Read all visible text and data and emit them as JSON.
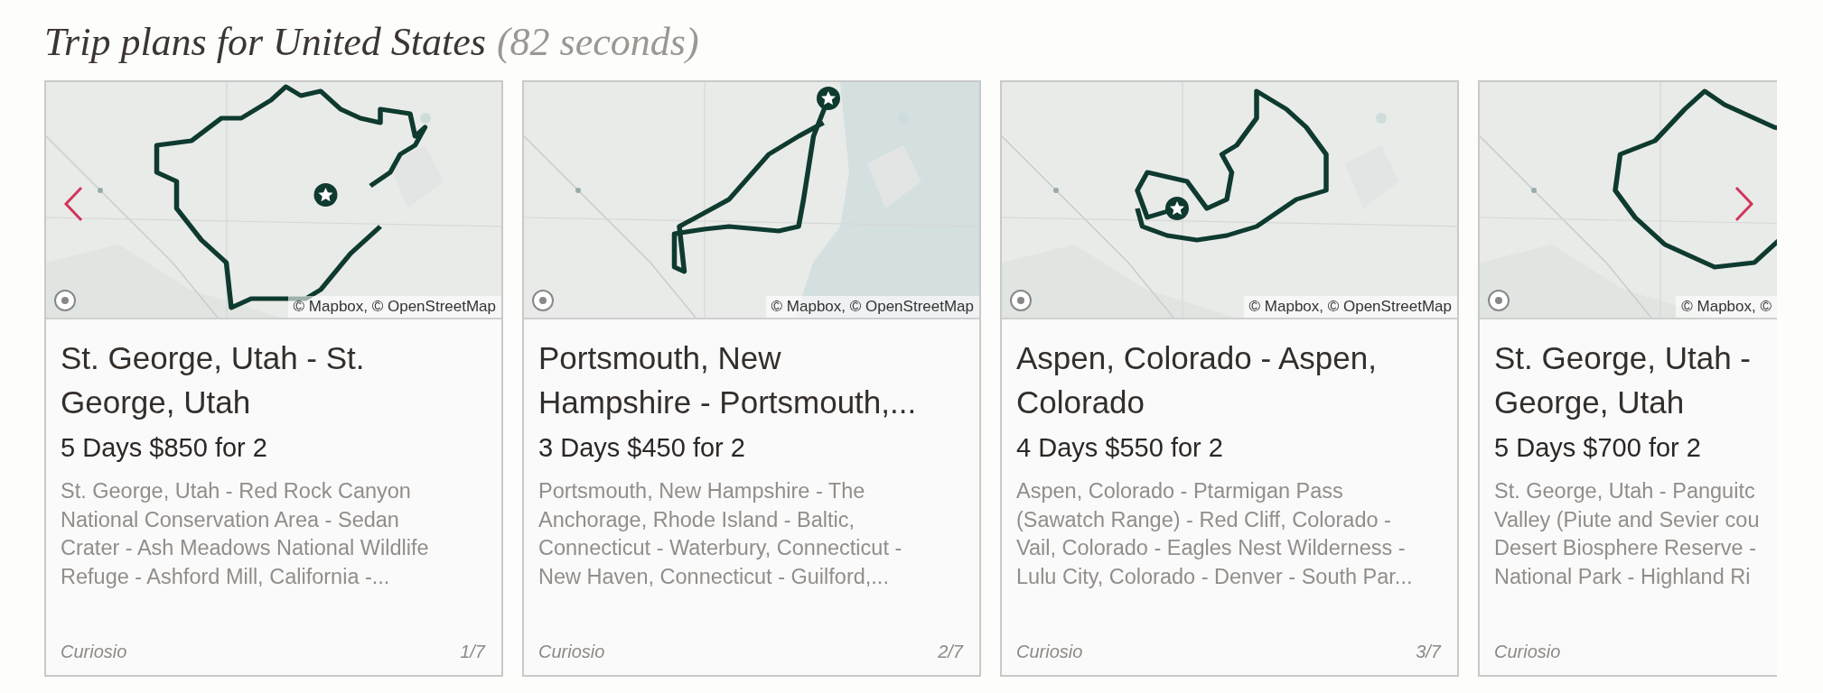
{
  "heading": {
    "title": "Trip plans for United States",
    "duration": "(82 seconds)"
  },
  "cards": [
    {
      "attribution": "© Mapbox, © OpenStreetMap",
      "title_lines": [
        "St. George, Utah - St.",
        "George, Utah"
      ],
      "price": "5 Days $850 for 2",
      "description_lines": [
        "St. George, Utah - Red Rock Canyon",
        "National Conservation Area - Sedan",
        "Crater - Ash Meadows National Wildlife",
        "Refuge - Ashford Mill, California -..."
      ],
      "source": "Curiosio",
      "index": "1/7"
    },
    {
      "attribution": "© Mapbox, © OpenStreetMap",
      "title_lines": [
        "Portsmouth, New",
        "Hampshire - Portsmouth,..."
      ],
      "price": "3 Days $450 for 2",
      "description_lines": [
        "Portsmouth, New Hampshire - The",
        "Anchorage, Rhode Island - Baltic,",
        "Connecticut - Waterbury, Connecticut -",
        "New Haven, Connecticut - Guilford,..."
      ],
      "source": "Curiosio",
      "index": "2/7"
    },
    {
      "attribution": "© Mapbox, © OpenStreetMap",
      "title_lines": [
        "Aspen, Colorado - Aspen,",
        "Colorado"
      ],
      "price": "4 Days $550 for 2",
      "description_lines": [
        "Aspen, Colorado - Ptarmigan Pass",
        "(Sawatch Range) - Red Cliff, Colorado -",
        "Vail, Colorado - Eagles Nest Wilderness -",
        "Lulu City, Colorado - Denver - South Par..."
      ],
      "source": "Curiosio",
      "index": "3/7"
    },
    {
      "attribution": "© Mapbox, ©",
      "title_lines": [
        "St. George, Utah -",
        "George, Utah"
      ],
      "price": "5 Days $700 for 2",
      "description_lines": [
        "St. George, Utah - Panguitc",
        "Valley (Piute and Sevier cou",
        "Desert Biosphere Reserve -",
        "National Park - Highland Ri"
      ],
      "source": "Curiosio"
    }
  ]
}
